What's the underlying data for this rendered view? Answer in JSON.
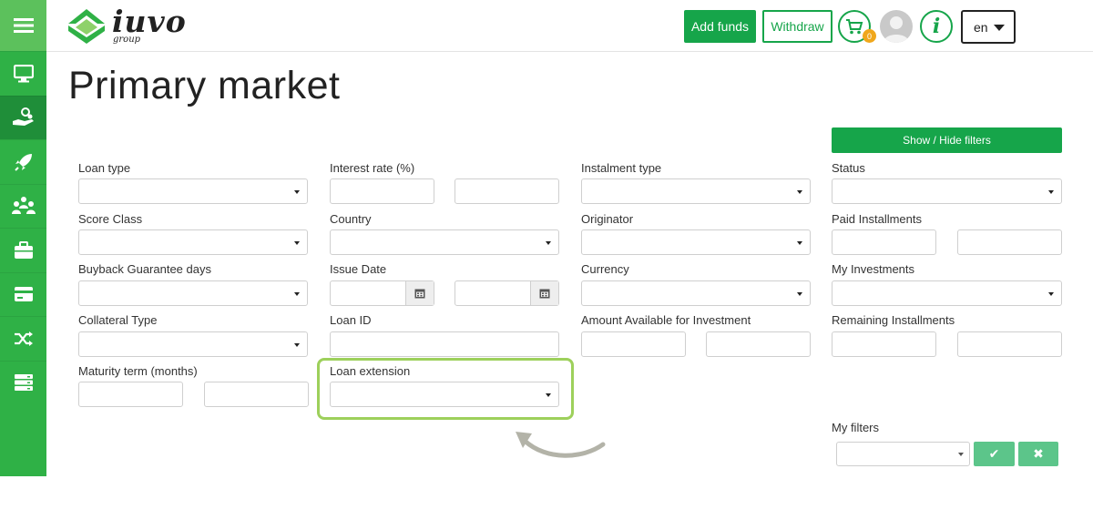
{
  "brand": {
    "name": "iuvo",
    "sub": "group"
  },
  "header": {
    "add_funds": "Add funds",
    "withdraw": "Withdraw",
    "cart_count": "0",
    "info_glyph": "i",
    "language": "en"
  },
  "sidebar": {
    "items": [
      {
        "icon": "monitor-icon"
      },
      {
        "icon": "hand-coins-icon",
        "active": true
      },
      {
        "icon": "rocket-icon"
      },
      {
        "icon": "users-icon"
      },
      {
        "icon": "briefcase-icon"
      },
      {
        "icon": "credit-card-icon"
      },
      {
        "icon": "shuffle-icon"
      },
      {
        "icon": "server-icon"
      }
    ]
  },
  "page": {
    "title": "Primary market"
  },
  "filters": {
    "toggle_label": "Show / Hide filters",
    "labels": {
      "loan_type": "Loan type",
      "interest_rate": "Interest rate (%)",
      "instalment_type": "Instalment type",
      "status": "Status",
      "score_class": "Score Class",
      "country": "Country",
      "originator": "Originator",
      "paid_installments": "Paid Installments",
      "buyback_guarantee": "Buyback Guarantee days",
      "issue_date": "Issue Date",
      "currency": "Currency",
      "my_investments": "My Investments",
      "collateral_type": "Collateral Type",
      "loan_id": "Loan ID",
      "amount_available": "Amount Available for Investment",
      "remaining_installments": "Remaining Installments",
      "maturity_term": "Maturity term (months)",
      "loan_extension": "Loan extension"
    },
    "my_filters_label": "My filters",
    "apply_glyph": "✔",
    "clear_glyph": "✖"
  },
  "colors": {
    "brand_green": "#16a54a",
    "sidebar_green": "#2fb146",
    "highlight": "#9dd05b",
    "badge": "#f0a71c"
  }
}
